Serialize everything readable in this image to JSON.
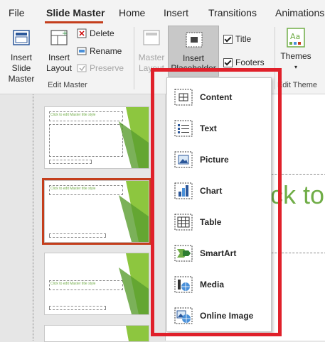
{
  "tabs": [
    "File",
    "Slide Master",
    "Home",
    "Insert",
    "Transitions",
    "Animations"
  ],
  "ribbon": {
    "insert_slide_master": "Insert Slide Master",
    "insert_layout": "Insert Layout",
    "delete": "Delete",
    "rename": "Rename",
    "preserve": "Preserve",
    "group_edit_master": "Edit Master",
    "master_layout": "Master Layout",
    "insert_placeholder": "Insert Placeholder",
    "title_check": "Title",
    "footers_check": "Footers",
    "themes": "Themes",
    "group_edit_theme": "Edit Theme"
  },
  "thumbnails": [
    {
      "title": "Click to edit Master title style"
    },
    {
      "title": "Click to edit Master title style"
    },
    {
      "title": "Click to edit Master title style"
    }
  ],
  "canvas": {
    "title_fragment": "ck to"
  },
  "placeholder_menu": [
    {
      "label": "Content",
      "icon": "content-icon"
    },
    {
      "label": "Text",
      "icon": "text-icon"
    },
    {
      "label": "Picture",
      "icon": "picture-icon"
    },
    {
      "label": "Chart",
      "icon": "chart-icon"
    },
    {
      "label": "Table",
      "icon": "table-icon"
    },
    {
      "label": "SmartArt",
      "icon": "smartart-icon"
    },
    {
      "label": "Media",
      "icon": "media-icon"
    },
    {
      "label": "Online Image",
      "icon": "online-image-icon"
    }
  ],
  "colors": {
    "accent": "#c43e1c",
    "highlight": "#e0202a",
    "theme_green": "#70ad47"
  }
}
